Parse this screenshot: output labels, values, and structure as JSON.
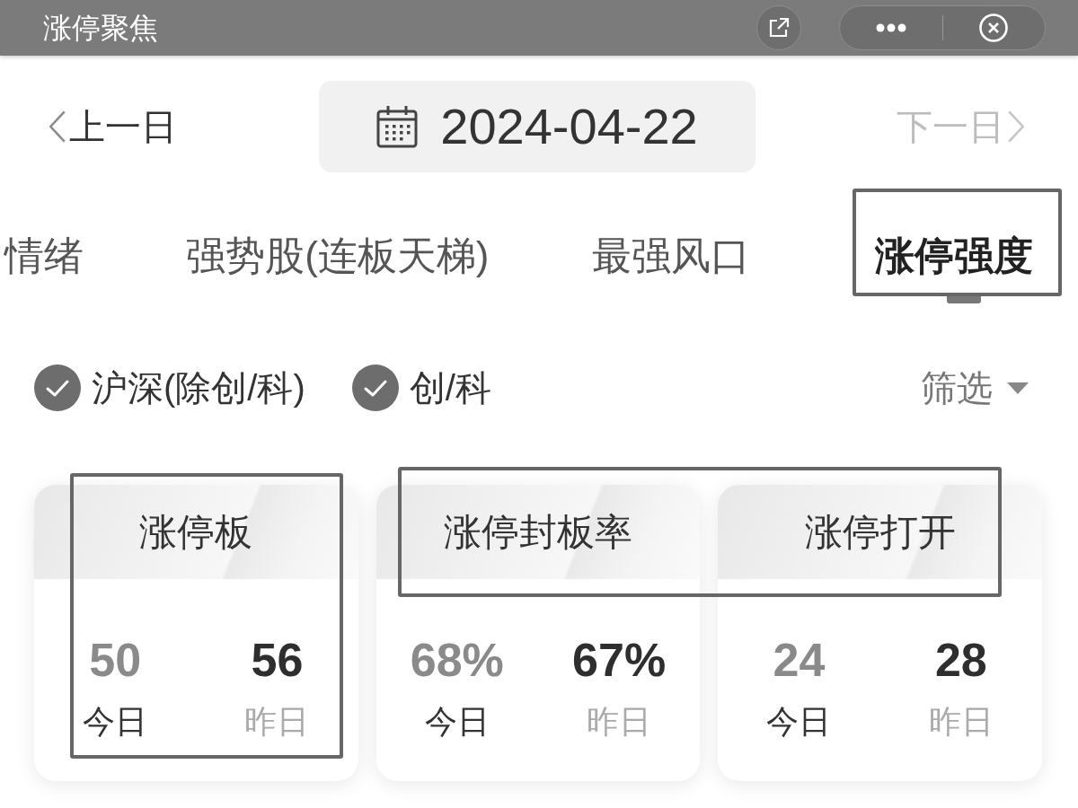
{
  "header": {
    "title": "涨停聚焦"
  },
  "date_nav": {
    "prev": {
      "label": "上一日",
      "disabled": false
    },
    "date": "2024-04-22",
    "next": {
      "label": "下一日",
      "disabled": true
    }
  },
  "tabs": [
    {
      "label": "情绪",
      "selected": false,
      "framed": false
    },
    {
      "label": "强势股(连板天梯)",
      "selected": false,
      "framed": false
    },
    {
      "label": "最强风口",
      "selected": false,
      "framed": false
    },
    {
      "label": "涨停强度",
      "selected": true,
      "framed": true
    }
  ],
  "filters": {
    "options": [
      {
        "label": "沪深(除创/科)",
        "checked": true
      },
      {
        "label": "创/科",
        "checked": true
      }
    ],
    "dropdown": "筛选"
  },
  "stats": {
    "cards": [
      {
        "title": "涨停板",
        "card_framed": true,
        "header_framed": false,
        "today": {
          "value": "50",
          "label": "今日"
        },
        "yesterday": {
          "value": "56",
          "label": "昨日"
        }
      },
      {
        "title": "涨停封板率",
        "card_framed": false,
        "header_framed": true,
        "today": {
          "value": "68%",
          "label": "今日"
        },
        "yesterday": {
          "value": "67%",
          "label": "昨日"
        }
      },
      {
        "title": "涨停打开",
        "card_framed": false,
        "header_framed": true,
        "today": {
          "value": "24",
          "label": "今日"
        },
        "yesterday": {
          "value": "28",
          "label": "昨日"
        }
      }
    ]
  }
}
